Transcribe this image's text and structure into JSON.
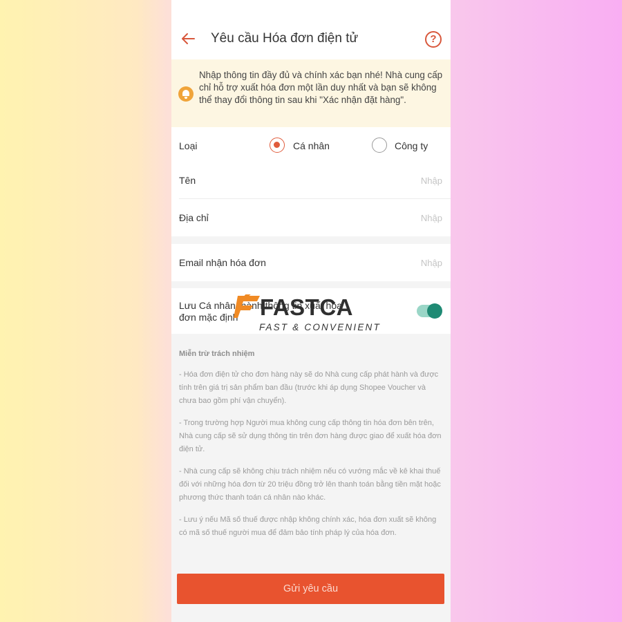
{
  "header": {
    "title": "Yêu cầu Hóa đơn điện tử",
    "back_icon": "arrow-left-icon",
    "help_icon": "question-circle-icon",
    "help_glyph": "?",
    "accent_color": "#d8573b"
  },
  "notice": {
    "icon": "bell-icon",
    "text": "Nhập thông tin đầy đủ và chính xác bạn nhé! Nhà cung cấp chỉ hỗ trợ xuất hóa đơn một lần duy nhất và bạn sẽ không thể thay đổi thông tin sau khi \"Xác nhận đặt hàng\"."
  },
  "form": {
    "type": {
      "label": "Loại",
      "options": [
        {
          "label": "Cá nhân",
          "selected": true
        },
        {
          "label": "Công ty",
          "selected": false
        }
      ]
    },
    "name": {
      "label": "Tên",
      "value": "",
      "placeholder": "Nhập"
    },
    "address": {
      "label": "Địa chỉ",
      "value": "",
      "placeholder": "Nhập"
    },
    "email": {
      "label": "Email nhận hóa đơn",
      "value": "",
      "placeholder": "Nhập"
    },
    "save_default": {
      "label": "Lưu Cá nhân thành thông tin xuất hóa đơn mặc định",
      "enabled": true,
      "toggle_color": "#1f8a74"
    }
  },
  "disclaimer": {
    "title": "Miễn trừ trách nhiệm",
    "paragraphs": [
      "- Hóa đơn điện tử cho đơn hàng này sẽ do Nhà cung cấp phát hành và được tính trên giá trị sản phẩm ban đầu (trước khi áp dụng Shopee Voucher và chưa bao gồm phí vận chuyển).",
      "- Trong trường hợp Người mua không cung cấp thông tin hóa đơn bên trên, Nhà cung cấp sẽ sử dụng thông tin trên đơn hàng được giao để xuất hóa đơn điện tử.",
      "- Nhà cung cấp sẽ không chịu trách nhiệm nếu có vướng mắc về kê khai thuế đối với những hóa đơn từ 20 triệu đồng trở lên thanh toán bằng tiền mặt hoặc phương thức thanh toán cá nhân nào khác.",
      "- Lưu ý nếu Mã số thuế được nhập không chính xác, hóa đơn xuất sẽ không có mã số thuế người mua để đảm bảo tính pháp lý của hóa đơn."
    ]
  },
  "submit": {
    "label": "Gửi yêu cầu",
    "color": "#e8532f"
  },
  "watermark": {
    "brand": "FASTCA",
    "tagline": "FAST & CONVENIENT"
  }
}
